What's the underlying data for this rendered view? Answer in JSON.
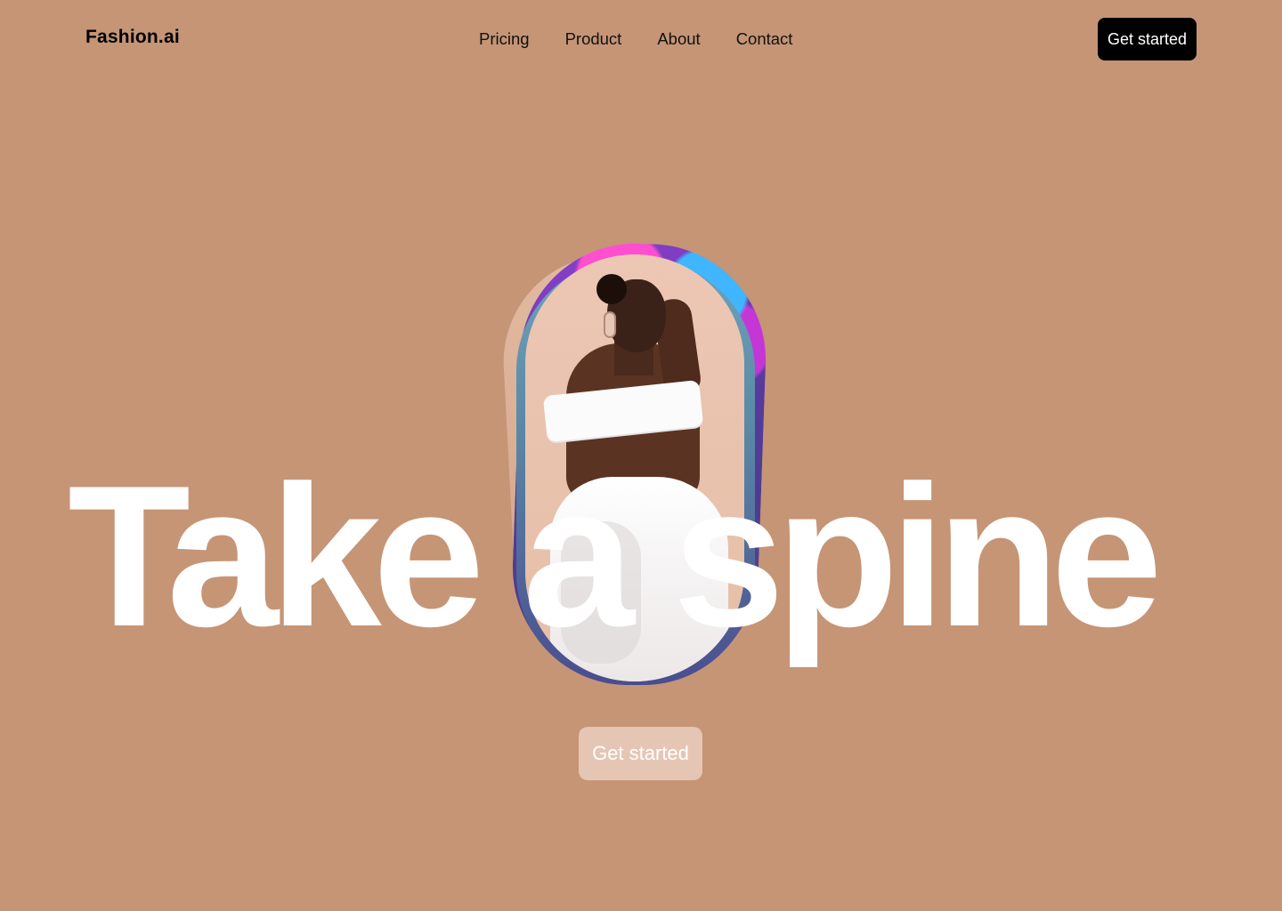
{
  "brand": {
    "logo": "Fashion.ai"
  },
  "nav": {
    "items": [
      {
        "label": "Pricing"
      },
      {
        "label": "Product"
      },
      {
        "label": "About"
      },
      {
        "label": "Contact"
      }
    ]
  },
  "header": {
    "cta_label": "Get started"
  },
  "hero": {
    "headline": "Take a spine",
    "cta_label": "Get started"
  },
  "colors": {
    "background": "#C59576",
    "header_cta_bg": "#000000",
    "hero_cta_bg": "#E5C6B4",
    "headline": "#FFFFFF"
  }
}
